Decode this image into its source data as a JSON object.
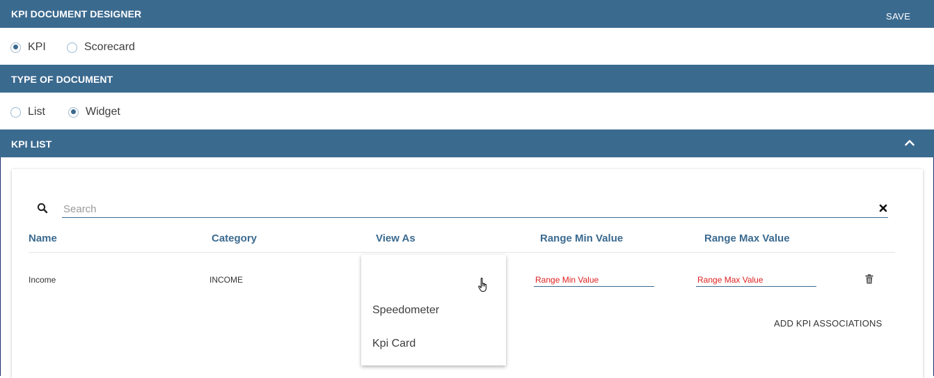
{
  "header": {
    "title": "KPI DOCUMENT DESIGNER",
    "save_label": "SAVE"
  },
  "document_kind": {
    "options": [
      {
        "label": "KPI",
        "checked": true
      },
      {
        "label": "Scorecard",
        "checked": false
      }
    ]
  },
  "type_section": {
    "title": "TYPE OF DOCUMENT"
  },
  "document_type": {
    "options": [
      {
        "label": "List",
        "checked": false
      },
      {
        "label": "Widget",
        "checked": true
      }
    ]
  },
  "kpi_list": {
    "title": "KPI LIST",
    "search_placeholder": "Search",
    "columns": [
      "Name",
      "Category",
      "View As",
      "Range Min Value",
      "Range Max Value"
    ],
    "rows": [
      {
        "name": "Income",
        "category": "INCOME",
        "view_as": "",
        "range_min_placeholder": "Range Min Value",
        "range_max_placeholder": "Range Max Value"
      }
    ],
    "view_as_options": [
      "",
      "Speedometer",
      "Kpi Card"
    ],
    "add_associations_label": "ADD KPI ASSOCIATIONS"
  },
  "icons": {
    "search": "search-icon",
    "clear": "close-icon",
    "collapse": "chevron-up-icon",
    "delete": "trash-icon",
    "cursor": "hand-pointer-icon"
  },
  "colors": {
    "header_bar": "#3b6a8f",
    "accent": "#3b6a8f",
    "error_placeholder": "#e02020"
  }
}
